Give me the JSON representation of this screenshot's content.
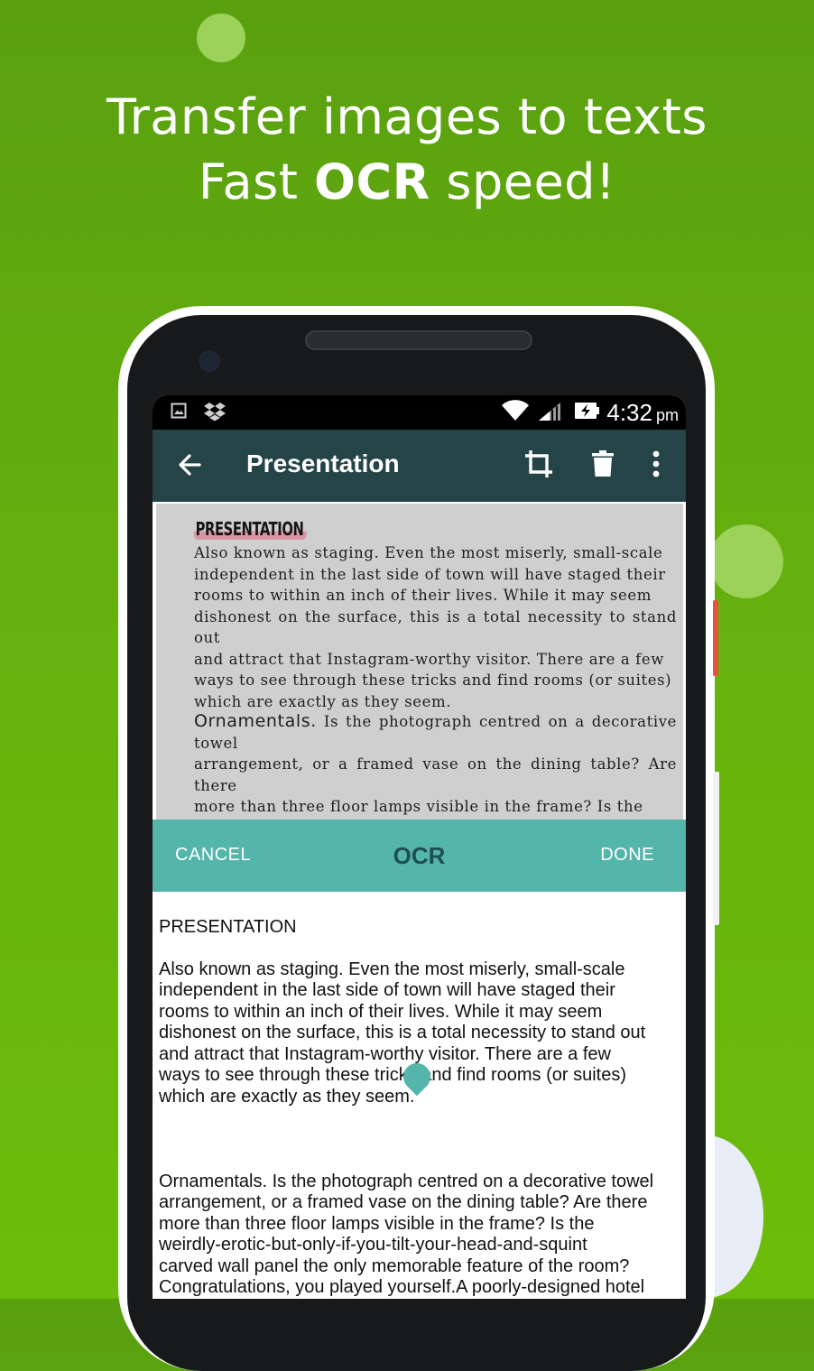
{
  "headline": {
    "line1": "Transfer images to texts",
    "line2_prefix": "Fast ",
    "line2_bold": "OCR",
    "line2_suffix": " speed!"
  },
  "colors": {
    "background": "#66b20e",
    "toolbar": "#254447",
    "ocr_bar": "#54b5ab",
    "accent_dot": "#9cd15a"
  },
  "statusbar": {
    "time": "4:32",
    "ampm": "pm",
    "icons": [
      "image-icon",
      "dropbox-icon",
      "wifi-icon",
      "signal-icon",
      "battery-charging-icon"
    ]
  },
  "toolbar": {
    "back_icon": "arrow-back-icon",
    "title": "Presentation",
    "crop_icon": "crop-icon",
    "delete_icon": "trash-icon",
    "more_icon": "more-vert-icon"
  },
  "scanned_page": {
    "heading": "PRESENTATION",
    "paragraph1": "Also known as staging. Even the most miserly, small-scale\nindependent in the last side of town will have staged their\nrooms to within an inch of their lives. While it may seem\ndishonest on the surface, this is a total necessity to stand out\nand attract that Instagram-worthy visitor. There are a few\nways to see through these tricks and find rooms (or suites)\nwhich are exactly as they seem.",
    "subheading": "Ornamentals.",
    "paragraph2": "Is the photograph centred on a decorative towel\narrangement, or a framed vase on the dining table? Are there\nmore than three floor lamps visible in the frame? Is the\nweirdly-erotic-but-only-if-you-tilt-your-head-and-squint\ncarved wall panel the only memorable feature of the room?"
  },
  "ocr_bar": {
    "cancel": "CANCEL",
    "title": "OCR",
    "done": "DONE"
  },
  "result_text": {
    "heading": "PRESENTATION",
    "paragraph1": "Also known as staging. Even the most miserly, small-scale\nindependent in the last side of town will have staged their\nrooms to within an inch of their lives. While it may seem\ndishonest on the surface, this is a total necessity to stand out\nand attract that Instagram-worthy visitor. There are a few\nways to see through these tricks and find rooms (or suites)\nwhich are exactly as they seem.",
    "paragraph2": "Ornamentals. Is the photograph centred on a decorative towel\narrangement, or a framed vase on the dining table? Are there\nmore than three floor lamps visible in the frame? Is the\nweirdly-erotic-but-only-if-you-tilt-your-head-and-squint\ncarved wall panel the only memorable feature of the room?\nCongratulations, you played yourself.A poorly-designed hotel\nroom is a poorly-maintained hotel room.A well-designed hotel\nroom doesn't rely on just the one floral arrangement or gilded\nchaise longue to entice you to visit-it's a whole package.\nSurroundinps. This is so often missed. If the majority of"
  }
}
